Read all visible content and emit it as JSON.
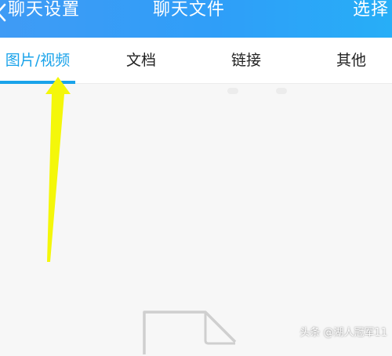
{
  "header": {
    "back_label": "聊天设置",
    "title": "聊天文件",
    "select_label": "选择"
  },
  "tabs": [
    {
      "label": "图片/视频",
      "active": true
    },
    {
      "label": "文档",
      "active": false
    },
    {
      "label": "链接",
      "active": false
    },
    {
      "label": "其他",
      "active": false
    }
  ],
  "watermark": "头条 @湖人冠军11",
  "colors": {
    "header_start": "#3f9bf5",
    "header_end": "#27aef7",
    "accent": "#1aa3ea",
    "arrow": "#f4f70a",
    "background": "#f7f7f7"
  },
  "icons": {
    "back": "chevron-left-icon",
    "empty": "document-icon",
    "annotation": "arrow-up-icon"
  }
}
